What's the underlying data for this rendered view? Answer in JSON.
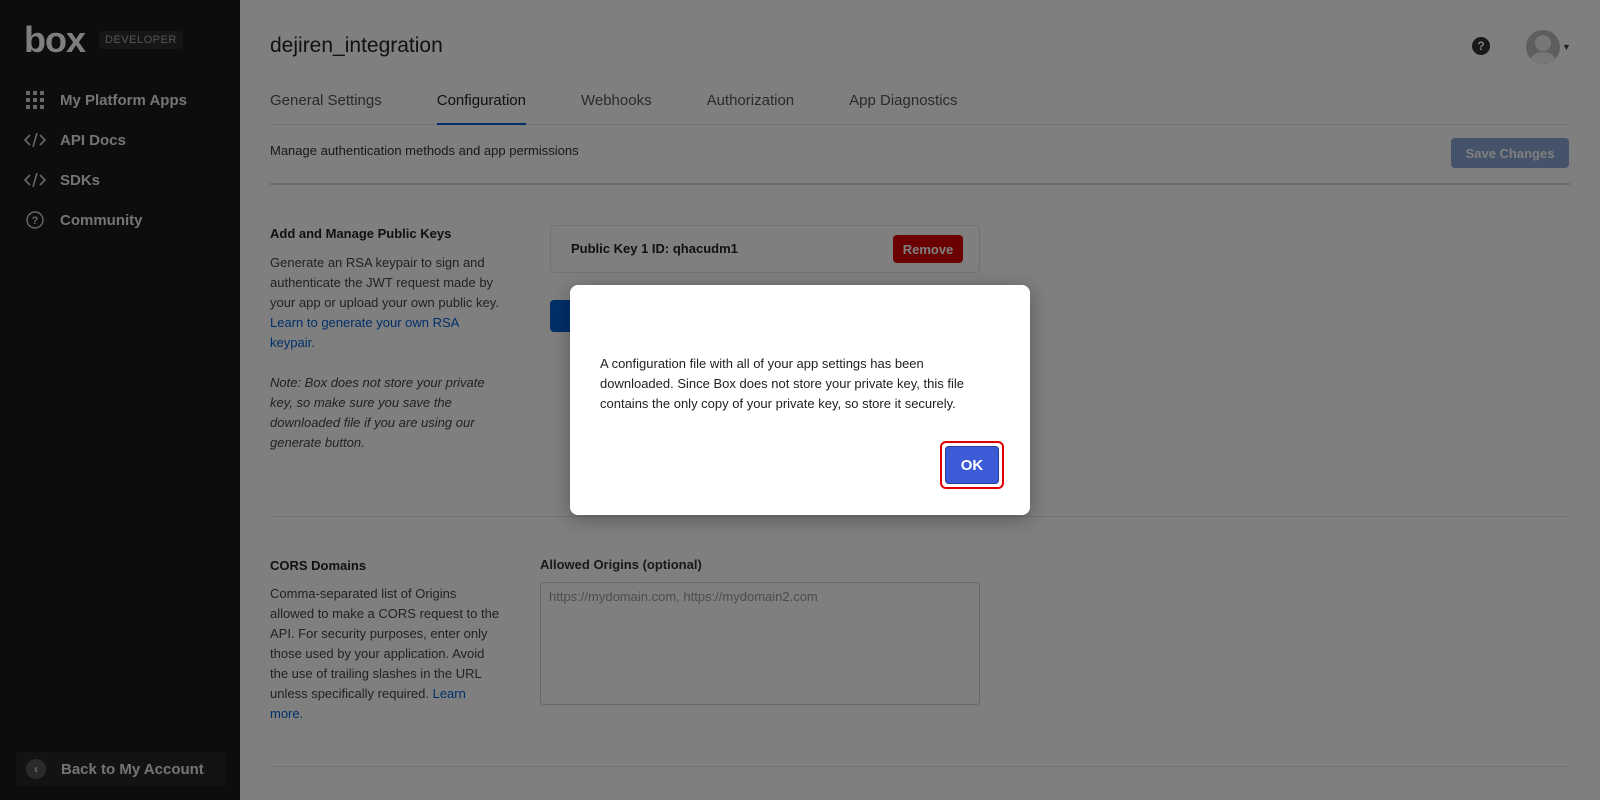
{
  "sidebar": {
    "brand": "box",
    "badge": "DEVELOPER",
    "items": [
      {
        "label": "My Platform Apps",
        "icon": "grid-icon"
      },
      {
        "label": "API Docs",
        "icon": "code-icon"
      },
      {
        "label": "SDKs",
        "icon": "code-icon"
      },
      {
        "label": "Community",
        "icon": "question-icon"
      }
    ],
    "back_label": "Back to My Account"
  },
  "header": {
    "app_name": "dejiren_integration",
    "help_glyph": "?"
  },
  "tabs": [
    {
      "label": "General Settings",
      "active": false
    },
    {
      "label": "Configuration",
      "active": true
    },
    {
      "label": "Webhooks",
      "active": false
    },
    {
      "label": "Authorization",
      "active": false
    },
    {
      "label": "App Diagnostics",
      "active": false
    }
  ],
  "subheader": {
    "text": "Manage authentication methods and app permissions",
    "save_label": "Save Changes"
  },
  "public_keys": {
    "title": "Add and Manage Public Keys",
    "desc_1": "Generate an RSA keypair to sign and authenticate the JWT request made by your app or upload your own public key.",
    "link": "Learn to generate your own RSA keypair.",
    "note": "Note: Box does not store your private key, so make sure you save the downloaded file if you are using our generate button.",
    "key_label": "Public Key 1 ID: qhacudm1",
    "remove_label": "Remove"
  },
  "cors": {
    "title": "CORS Domains",
    "desc": "Comma-separated list of Origins allowed to make a CORS request to the API. For security purposes, enter only those used by your application. Avoid the use of trailing slashes in the URL unless specifically required.",
    "link": "Learn more.",
    "field_label": "Allowed Origins (optional)",
    "placeholder": "https://mydomain.com, https://mydomain2.com",
    "value": ""
  },
  "modal": {
    "message": "A configuration file with all of your app settings has been downloaded. Since Box does not store your private key, this file contains the only copy of your private key, so store it securely.",
    "ok_label": "OK"
  },
  "colors": {
    "accent": "#0061d5",
    "danger": "#d50000",
    "ok_button": "#3d5bd6",
    "sidebar_bg": "#1a1a1a"
  }
}
